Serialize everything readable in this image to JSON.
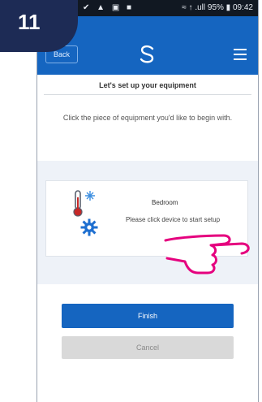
{
  "step": {
    "number": "11"
  },
  "status_bar": {
    "left_icons": "✔ ▲ ▣ ■",
    "right": "≈ ↑ .ull 95% ▮ 09:42"
  },
  "app_bar": {
    "back_label": "Back",
    "logo_icon": "swirl-logo-icon",
    "menu_icon": "hamburger-menu-icon"
  },
  "page": {
    "title": "Let's set up your equipment",
    "instruction": "Click the piece of equipment you'd like to begin with."
  },
  "device": {
    "name": "Bedroom",
    "prompt": "Please click device to start setup",
    "icons": [
      "thermometer-icon",
      "gear-icon"
    ]
  },
  "actions": {
    "next_label": "Finish",
    "cancel_label": "Cancel"
  },
  "colors": {
    "accent": "#1565c0",
    "badge": "#1d2b55",
    "hand_pointer": "#e5007e",
    "panel": "#eef2f8"
  }
}
